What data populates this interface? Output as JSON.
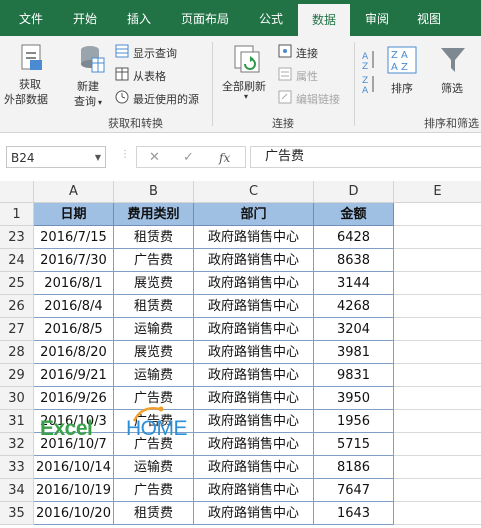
{
  "tabs": [
    {
      "label": "文件"
    },
    {
      "label": "开始"
    },
    {
      "label": "插入"
    },
    {
      "label": "页面布局"
    },
    {
      "label": "公式"
    },
    {
      "label": "数据"
    },
    {
      "label": "审阅"
    },
    {
      "label": "视图"
    }
  ],
  "ribbon": {
    "get_external_data": [
      "获取",
      "外部数据"
    ],
    "new_query": [
      "新建",
      "查询"
    ],
    "show_queries": "显示查询",
    "from_table": "从表格",
    "recent_sources": "最近使用的源",
    "group_get_transform": "获取和转换",
    "refresh_all": "全部刷新",
    "connections": "连接",
    "properties": "属性",
    "edit_links": "编辑链接",
    "group_connections": "连接",
    "sort": "排序",
    "filter": "筛选",
    "group_sort_filter": "排序和筛选"
  },
  "formula_bar": {
    "name_box": "B24",
    "cancel_glyph": "✕",
    "enter_glyph": "✓",
    "fx_glyph": "fx",
    "value": "广告费"
  },
  "grid": {
    "columns": [
      "A",
      "B",
      "C",
      "D",
      "E"
    ],
    "header_row": {
      "row": "1",
      "cells": [
        "日期",
        "费用类别",
        "部门",
        "金额"
      ]
    },
    "rows": [
      {
        "row": "23",
        "cells": [
          "2016/7/15",
          "租赁费",
          "政府路销售中心",
          "6428"
        ]
      },
      {
        "row": "24",
        "cells": [
          "2016/7/30",
          "广告费",
          "政府路销售中心",
          "8638"
        ]
      },
      {
        "row": "25",
        "cells": [
          "2016/8/1",
          "展览费",
          "政府路销售中心",
          "3144"
        ]
      },
      {
        "row": "26",
        "cells": [
          "2016/8/4",
          "租赁费",
          "政府路销售中心",
          "4268"
        ]
      },
      {
        "row": "27",
        "cells": [
          "2016/8/5",
          "运输费",
          "政府路销售中心",
          "3204"
        ]
      },
      {
        "row": "28",
        "cells": [
          "2016/8/20",
          "展览费",
          "政府路销售中心",
          "3981"
        ]
      },
      {
        "row": "29",
        "cells": [
          "2016/9/21",
          "运输费",
          "政府路销售中心",
          "9831"
        ]
      },
      {
        "row": "30",
        "cells": [
          "2016/9/26",
          "广告费",
          "政府路销售中心",
          "3950"
        ]
      },
      {
        "row": "31",
        "cells": [
          "2016/10/3",
          "广告费",
          "政府路销售中心",
          "1956"
        ]
      },
      {
        "row": "32",
        "cells": [
          "2016/10/7",
          "广告费",
          "政府路销售中心",
          "5715"
        ]
      },
      {
        "row": "33",
        "cells": [
          "2016/10/14",
          "运输费",
          "政府路销售中心",
          "8186"
        ]
      },
      {
        "row": "34",
        "cells": [
          "2016/10/19",
          "广告费",
          "政府路销售中心",
          "7647"
        ]
      },
      {
        "row": "35",
        "cells": [
          "2016/10/20",
          "租赁费",
          "政府路销售中心",
          "1643"
        ]
      }
    ]
  },
  "watermark": {
    "part1": "Excel",
    "part2": "HOME"
  },
  "colors": {
    "accent": "#217346",
    "header_fill": "#9fbfe3",
    "watermark_green": "#3aa04a",
    "watermark_blue": "#2c8fd6"
  }
}
